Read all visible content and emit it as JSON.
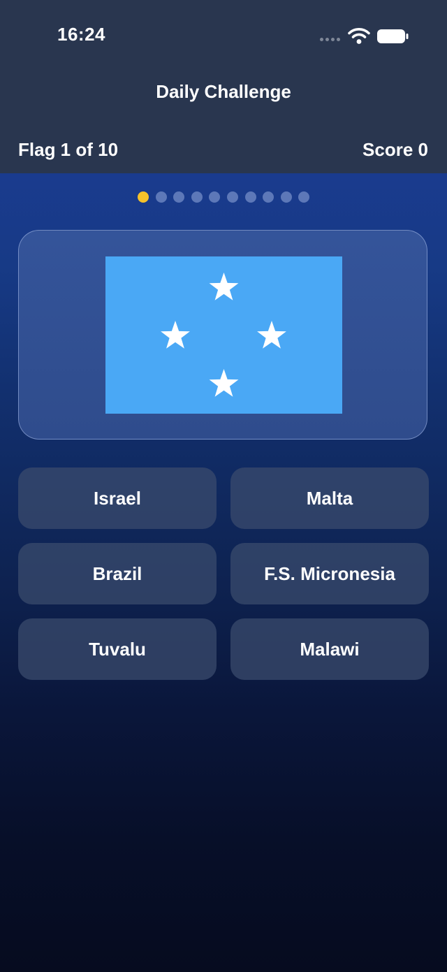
{
  "status_bar": {
    "time": "16:24",
    "icons": [
      "signal-icon",
      "wifi-icon",
      "battery-icon"
    ]
  },
  "header": {
    "title": "Daily Challenge",
    "flag_counter": "Flag 1 of 10",
    "score": "Score 0"
  },
  "progress": {
    "current": 1,
    "total": 10,
    "active_color": "#f5c22b"
  },
  "flag": {
    "country": "F.S. Micronesia",
    "background_color": "#4aa8f5",
    "star_color": "#ffffff"
  },
  "answers": [
    {
      "label": "Israel"
    },
    {
      "label": "Malta"
    },
    {
      "label": "Brazil"
    },
    {
      "label": "F.S. Micronesia"
    },
    {
      "label": "Tuvalu"
    },
    {
      "label": "Malawi"
    }
  ]
}
